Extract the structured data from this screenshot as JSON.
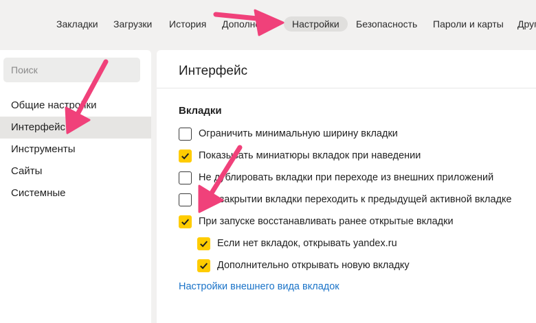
{
  "nav": {
    "tabs": [
      {
        "label": "Закладки"
      },
      {
        "label": "Загрузки"
      },
      {
        "label": "История"
      },
      {
        "label": "Дополнения"
      },
      {
        "label": "Настройки"
      },
      {
        "label": "Безопасность"
      },
      {
        "label": "Пароли и карты"
      },
      {
        "label": "Другие"
      }
    ],
    "active_tab": "Настройки"
  },
  "sidebar": {
    "search_placeholder": "Поиск",
    "items": [
      {
        "label": "Общие настройки"
      },
      {
        "label": "Интерфейс"
      },
      {
        "label": "Инструменты"
      },
      {
        "label": "Сайты"
      },
      {
        "label": "Системные"
      }
    ],
    "active_item": "Интерфейс"
  },
  "main": {
    "title": "Интерфейс",
    "section": {
      "title": "Вкладки",
      "options": [
        {
          "label": "Ограничить минимальную ширину вкладки",
          "checked": false
        },
        {
          "label": "Показывать миниатюры вкладок при наведении",
          "checked": true
        },
        {
          "label": "Не дублировать вкладки при переходе из внешних приложений",
          "checked": false
        },
        {
          "label": "При закрытии вкладки переходить к предыдущей активной вкладке",
          "checked": false
        },
        {
          "label": "При запуске восстанавливать ранее открытые вкладки",
          "checked": true
        },
        {
          "label": "Если нет вкладок, открывать yandex.ru",
          "checked": true
        },
        {
          "label": "Дополнительно открывать новую вкладку",
          "checked": true
        }
      ],
      "link": "Настройки внешнего вида вкладок"
    }
  },
  "colors": {
    "accent_checkbox": "#ffcc00",
    "link": "#1a73c8",
    "annotation_arrow": "#f0417a"
  }
}
